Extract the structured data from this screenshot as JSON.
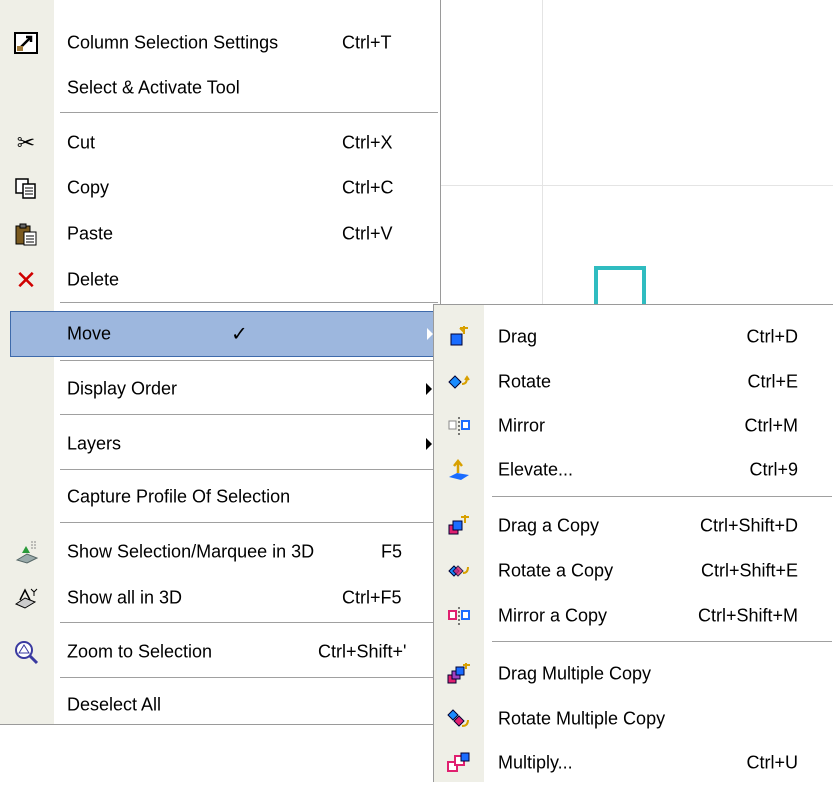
{
  "colors": {
    "highlight": "#9db7de",
    "highlight_border": "#3e6aab",
    "gutter": "#efefe7",
    "shape": "#2fbcc0"
  },
  "menu": {
    "items": [
      {
        "label": "Column Selection Settings",
        "shortcut": "Ctrl+T",
        "icon": "column-settings-icon"
      },
      {
        "label": "Select & Activate Tool",
        "shortcut": ""
      },
      {
        "label": "Cut",
        "shortcut": "Ctrl+X",
        "icon": "scissors-icon"
      },
      {
        "label": "Copy",
        "shortcut": "Ctrl+C",
        "icon": "copy-icon"
      },
      {
        "label": "Paste",
        "shortcut": "Ctrl+V",
        "icon": "paste-icon"
      },
      {
        "label": "Delete",
        "shortcut": "",
        "icon": "delete-x-icon"
      },
      {
        "label": "Move",
        "check": "✓",
        "submenu": true
      },
      {
        "label": "Display Order",
        "submenu": true
      },
      {
        "label": "Layers",
        "submenu": true
      },
      {
        "label": "Capture Profile Of Selection",
        "shortcut": ""
      },
      {
        "label": "Show Selection/Marquee in 3D",
        "shortcut": "F5",
        "icon": "show-selection-3d-icon"
      },
      {
        "label": "Show all in 3D",
        "shortcut": "Ctrl+F5",
        "icon": "show-all-3d-icon"
      },
      {
        "label": "Zoom to Selection",
        "shortcut": "Ctrl+Shift+'",
        "icon": "zoom-selection-icon"
      },
      {
        "label": "Deselect All",
        "shortcut": ""
      }
    ]
  },
  "submenu": {
    "items": [
      {
        "label": "Drag",
        "shortcut": "Ctrl+D",
        "icon": "drag-icon"
      },
      {
        "label": "Rotate",
        "shortcut": "Ctrl+E",
        "icon": "rotate-icon"
      },
      {
        "label": "Mirror",
        "shortcut": "Ctrl+M",
        "icon": "mirror-icon"
      },
      {
        "label": "Elevate...",
        "shortcut": "Ctrl+9",
        "icon": "elevate-icon"
      },
      {
        "label": "Drag a Copy",
        "shortcut": "Ctrl+Shift+D",
        "icon": "drag-copy-icon"
      },
      {
        "label": "Rotate a Copy",
        "shortcut": "Ctrl+Shift+E",
        "icon": "rotate-copy-icon"
      },
      {
        "label": "Mirror a Copy",
        "shortcut": "Ctrl+Shift+M",
        "icon": "mirror-copy-icon"
      },
      {
        "label": "Drag Multiple Copy",
        "shortcut": "",
        "icon": "drag-multiple-icon"
      },
      {
        "label": "Rotate Multiple Copy",
        "shortcut": "",
        "icon": "rotate-multiple-icon"
      },
      {
        "label": "Multiply...",
        "shortcut": "Ctrl+U",
        "icon": "multiply-icon"
      }
    ]
  }
}
